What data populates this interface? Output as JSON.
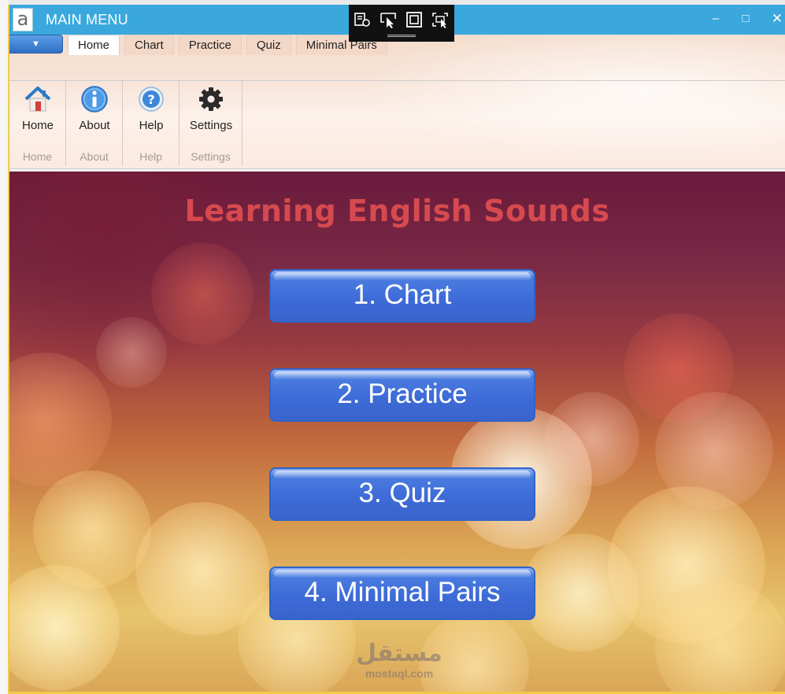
{
  "window": {
    "title": "MAIN MENU",
    "app_logo": "a"
  },
  "window_controls": {
    "minimize": "–",
    "maximize": "□",
    "close": "✕"
  },
  "app_menu": {
    "label": "▼"
  },
  "tabs": [
    {
      "label": "Home",
      "active": true
    },
    {
      "label": "Chart",
      "active": false
    },
    {
      "label": "Practice",
      "active": false
    },
    {
      "label": "Quiz",
      "active": false
    },
    {
      "label": "Minimal Pairs",
      "active": false
    }
  ],
  "ribbon": {
    "groups": [
      {
        "label": "Home",
        "button": {
          "label": "Home",
          "icon": "house-icon"
        }
      },
      {
        "label": "About",
        "button": {
          "label": "About",
          "icon": "info-icon"
        }
      },
      {
        "label": "Help",
        "button": {
          "label": "Help",
          "icon": "question-icon"
        }
      },
      {
        "label": "Settings",
        "button": {
          "label": "Settings",
          "icon": "gear-icon"
        }
      }
    ]
  },
  "main": {
    "title": "Learning English Sounds",
    "buttons": [
      {
        "label": "1. Chart"
      },
      {
        "label": "2. Practice"
      },
      {
        "label": "3. Quiz"
      },
      {
        "label": "4. Minimal Pairs"
      }
    ],
    "watermark": {
      "arabic": "مستقل",
      "site": "mostaql.com"
    }
  },
  "colors": {
    "titlebar": "#3aa8dd",
    "title_text": "#d64a4f",
    "button_blue": "#3e6bd8",
    "window_border": "#f2c94c"
  }
}
